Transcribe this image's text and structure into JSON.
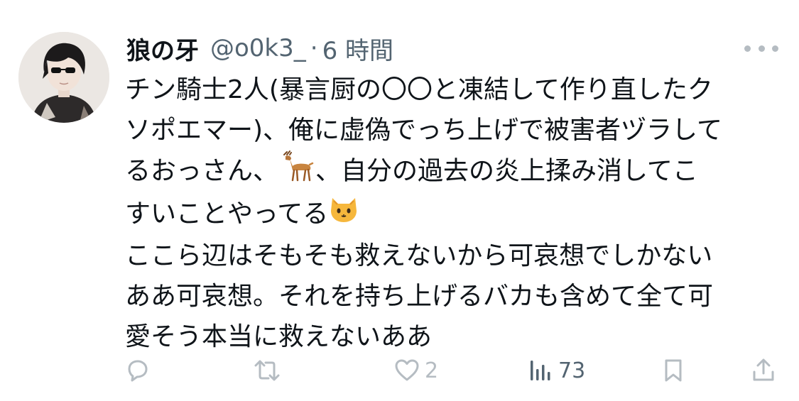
{
  "tweet": {
    "display_name": "狼の牙",
    "handle": "@o0k3_",
    "separator": "·",
    "time": "6 時間",
    "lines": {
      "l1": "チン騎士2人(暴言厨の〇〇と凍結して作り直したク",
      "l2": "ソポエマー)、俺に虚偽でっち上げで被害者ヅラして",
      "l3a": "るおっさん、",
      "l3b": "、自分の過去の炎上揉み消してこ",
      "l4": "すいことやってる",
      "l5": "ここら辺はそもそも救えないから可哀想でしかない",
      "l6": "ああ可哀想。それを持ち上げるバカも含めて全て可",
      "l7": "愛そう本当に救えないああ"
    },
    "emojis": {
      "deer": "deer-emoji",
      "cat": "cat-face-emoji"
    }
  },
  "actions": {
    "reply_count": "",
    "retweet_count": "",
    "like_count": "2",
    "views_count": "73"
  },
  "icons": {
    "reply": "reply-icon",
    "retweet": "retweet-icon",
    "like": "heart-icon",
    "views": "bar-chart-icon",
    "bookmark": "bookmark-icon",
    "share": "share-icon",
    "more": "more-dots-icon"
  },
  "colors": {
    "text": "#0f1419",
    "secondary": "#536471",
    "icon_muted": "#b5bcc2"
  }
}
